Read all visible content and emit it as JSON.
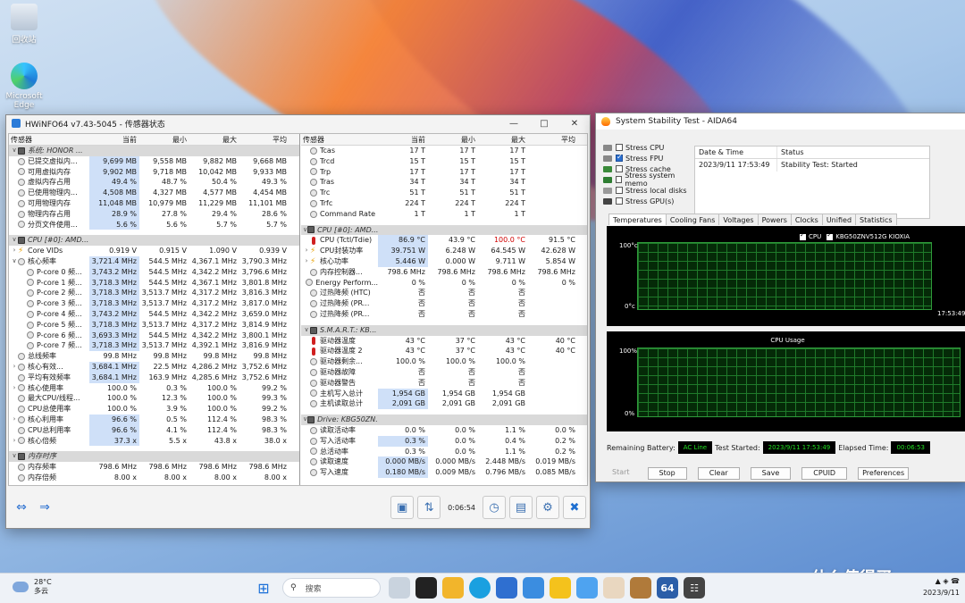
{
  "desktop": {
    "icons": [
      {
        "label": "回收站"
      },
      {
        "label": "Microsoft Edge"
      }
    ],
    "watermark": "什么值得买"
  },
  "hwinfo": {
    "title": "HWiNFO64 v7.43-5045 - 传感器状态",
    "left_headers": [
      "传感器",
      "当前",
      "最小",
      "最大",
      "平均"
    ],
    "left_rows": [
      {
        "t": "grp",
        "label": "系统: HONOR ..."
      },
      {
        "t": "r",
        "icon": "circle",
        "label": "已提交虚拟内...",
        "v": [
          "9,699 MB",
          "9,558 MB",
          "9,882 MB",
          "9,668 MB"
        ],
        "hl": true
      },
      {
        "t": "r",
        "icon": "circle",
        "label": "可用虚拟内存",
        "v": [
          "9,902 MB",
          "9,718 MB",
          "10,042 MB",
          "9,933 MB"
        ],
        "hl": true
      },
      {
        "t": "r",
        "icon": "circle",
        "label": "虚拟内存占用",
        "v": [
          "49.4 %",
          "48.7 %",
          "50.4 %",
          "49.3 %"
        ],
        "hl": true
      },
      {
        "t": "r",
        "icon": "circle",
        "label": "已使用物理内...",
        "v": [
          "4,508 MB",
          "4,327 MB",
          "4,577 MB",
          "4,454 MB"
        ],
        "hl": true
      },
      {
        "t": "r",
        "icon": "circle",
        "label": "可用物理内存",
        "v": [
          "11,048 MB",
          "10,979 MB",
          "11,229 MB",
          "11,101 MB"
        ],
        "hl": true
      },
      {
        "t": "r",
        "icon": "circle",
        "label": "物理内存占用",
        "v": [
          "28.9 %",
          "27.8 %",
          "29.4 %",
          "28.6 %"
        ],
        "hl": true
      },
      {
        "t": "r",
        "icon": "circle",
        "label": "分页文件使用...",
        "v": [
          "5.6 %",
          "5.6 %",
          "5.7 %",
          "5.7 %"
        ],
        "hl": true
      },
      {
        "t": "blank"
      },
      {
        "t": "grp",
        "label": "CPU [#0]: AMD..."
      },
      {
        "t": "r",
        "tw": ">",
        "icon": "bolt",
        "label": "Core VIDs",
        "v": [
          "0.919 V",
          "0.915 V",
          "1.090 V",
          "0.939 V"
        ]
      },
      {
        "t": "r",
        "tw": "v",
        "icon": "circle",
        "label": "核心频率",
        "v": [
          "3,721.4 MHz",
          "544.5 MHz",
          "4,367.1 MHz",
          "3,790.3 MHz"
        ],
        "hl": true
      },
      {
        "t": "r",
        "ind": true,
        "icon": "circle",
        "label": "P-core 0 频...",
        "v": [
          "3,743.2 MHz",
          "544.5 MHz",
          "4,342.2 MHz",
          "3,796.6 MHz"
        ],
        "hl": true
      },
      {
        "t": "r",
        "ind": true,
        "icon": "circle",
        "label": "P-core 1 频...",
        "v": [
          "3,718.3 MHz",
          "544.5 MHz",
          "4,367.1 MHz",
          "3,801.8 MHz"
        ],
        "hl": true
      },
      {
        "t": "r",
        "ind": true,
        "icon": "circle",
        "label": "P-core 2 频...",
        "v": [
          "3,718.3 MHz",
          "3,513.7 MHz",
          "4,317.2 MHz",
          "3,816.3 MHz"
        ],
        "hl": true
      },
      {
        "t": "r",
        "ind": true,
        "icon": "circle",
        "label": "P-core 3 频...",
        "v": [
          "3,718.3 MHz",
          "3,513.7 MHz",
          "4,317.2 MHz",
          "3,817.0 MHz"
        ],
        "hl": true
      },
      {
        "t": "r",
        "ind": true,
        "icon": "circle",
        "label": "P-core 4 频...",
        "v": [
          "3,743.2 MHz",
          "544.5 MHz",
          "4,342.2 MHz",
          "3,659.0 MHz"
        ],
        "hl": true
      },
      {
        "t": "r",
        "ind": true,
        "icon": "circle",
        "label": "P-core 5 频...",
        "v": [
          "3,718.3 MHz",
          "3,513.7 MHz",
          "4,317.2 MHz",
          "3,814.9 MHz"
        ],
        "hl": true
      },
      {
        "t": "r",
        "ind": true,
        "icon": "circle",
        "label": "P-core 6 频...",
        "v": [
          "3,693.3 MHz",
          "544.5 MHz",
          "4,342.2 MHz",
          "3,800.1 MHz"
        ],
        "hl": true
      },
      {
        "t": "r",
        "ind": true,
        "icon": "circle",
        "label": "P-core 7 频...",
        "v": [
          "3,718.3 MHz",
          "3,513.7 MHz",
          "4,392.1 MHz",
          "3,816.9 MHz"
        ],
        "hl": true
      },
      {
        "t": "r",
        "icon": "circle",
        "label": "总线频率",
        "v": [
          "99.8 MHz",
          "99.8 MHz",
          "99.8 MHz",
          "99.8 MHz"
        ]
      },
      {
        "t": "r",
        "tw": ">",
        "icon": "circle",
        "label": "核心有效...",
        "v": [
          "3,684.1 MHz",
          "22.5 MHz",
          "4,286.2 MHz",
          "3,752.6 MHz"
        ],
        "hl": true
      },
      {
        "t": "r",
        "icon": "circle",
        "label": "平均有效频率",
        "v": [
          "3,684.1 MHz",
          "163.9 MHz",
          "4,285.6 MHz",
          "3,752.6 MHz"
        ],
        "hl": true
      },
      {
        "t": "r",
        "tw": ">",
        "icon": "circle",
        "label": "核心使用率",
        "v": [
          "100.0 %",
          "0.3 %",
          "100.0 %",
          "99.2 %"
        ]
      },
      {
        "t": "r",
        "icon": "circle",
        "label": "最大CPU/线程...",
        "v": [
          "100.0 %",
          "12.3 %",
          "100.0 %",
          "99.3 %"
        ]
      },
      {
        "t": "r",
        "icon": "circle",
        "label": "CPU总使用率",
        "v": [
          "100.0 %",
          "3.9 %",
          "100.0 %",
          "99.2 %"
        ]
      },
      {
        "t": "r",
        "tw": ">",
        "icon": "circle",
        "label": "核心利用率",
        "v": [
          "96.6 %",
          "0.5 %",
          "112.4 %",
          "98.3 %"
        ],
        "hl": true
      },
      {
        "t": "r",
        "icon": "circle",
        "label": "CPU总利用率",
        "v": [
          "96.6 %",
          "4.1 %",
          "112.4 %",
          "98.3 %"
        ],
        "hl": true
      },
      {
        "t": "r",
        "tw": ">",
        "icon": "circle",
        "label": "核心倍频",
        "v": [
          "37.3 x",
          "5.5 x",
          "43.8 x",
          "38.0 x"
        ],
        "hl": true
      },
      {
        "t": "blank"
      },
      {
        "t": "grp",
        "label": "内存时序"
      },
      {
        "t": "r",
        "icon": "circle",
        "label": "内存频率",
        "v": [
          "798.6 MHz",
          "798.6 MHz",
          "798.6 MHz",
          "798.6 MHz"
        ]
      },
      {
        "t": "r",
        "icon": "circle",
        "label": "内存倍频",
        "v": [
          "8.00 x",
          "8.00 x",
          "8.00 x",
          "8.00 x"
        ]
      }
    ],
    "right_headers": [
      "传感器",
      "当前",
      "最小",
      "最大",
      "平均"
    ],
    "right_rows": [
      {
        "t": "r",
        "icon": "circle",
        "label": "Tcas",
        "v": [
          "17 T",
          "17 T",
          "17 T",
          ""
        ]
      },
      {
        "t": "r",
        "icon": "circle",
        "label": "Trcd",
        "v": [
          "15 T",
          "15 T",
          "15 T",
          ""
        ]
      },
      {
        "t": "r",
        "icon": "circle",
        "label": "Trp",
        "v": [
          "17 T",
          "17 T",
          "17 T",
          ""
        ]
      },
      {
        "t": "r",
        "icon": "circle",
        "label": "Tras",
        "v": [
          "34 T",
          "34 T",
          "34 T",
          ""
        ]
      },
      {
        "t": "r",
        "icon": "circle",
        "label": "Trc",
        "v": [
          "51 T",
          "51 T",
          "51 T",
          ""
        ]
      },
      {
        "t": "r",
        "icon": "circle",
        "label": "Trfc",
        "v": [
          "224 T",
          "224 T",
          "224 T",
          ""
        ]
      },
      {
        "t": "r",
        "icon": "circle",
        "label": "Command Rate",
        "v": [
          "1 T",
          "1 T",
          "1 T",
          ""
        ]
      },
      {
        "t": "blank"
      },
      {
        "t": "grp",
        "label": "CPU [#0]: AMD..."
      },
      {
        "t": "r",
        "icon": "therm",
        "label": "CPU (Tctl/Tdie)",
        "v": [
          "86.9 °C",
          "43.9 °C",
          "100.0 °C",
          "91.5 °C"
        ],
        "hl": true,
        "red": 2
      },
      {
        "t": "r",
        "tw": ">",
        "icon": "bolt",
        "label": "CPU封装功率",
        "v": [
          "39.751 W",
          "6.248 W",
          "64.545 W",
          "42.628 W"
        ],
        "hl": true
      },
      {
        "t": "r",
        "tw": ">",
        "icon": "bolt",
        "label": "核心功率",
        "v": [
          "5.446 W",
          "0.000 W",
          "9.711 W",
          "5.854 W"
        ],
        "hl": true
      },
      {
        "t": "r",
        "icon": "circle",
        "label": "内存控制器...",
        "v": [
          "798.6 MHz",
          "798.6 MHz",
          "798.6 MHz",
          "798.6 MHz"
        ]
      },
      {
        "t": "r",
        "icon": "circle",
        "label": "Energy Perform...",
        "v": [
          "0 %",
          "0 %",
          "0 %",
          "0 %"
        ]
      },
      {
        "t": "r",
        "icon": "circle",
        "label": "过热降频 (HTC)",
        "v": [
          "否",
          "否",
          "否",
          ""
        ]
      },
      {
        "t": "r",
        "icon": "circle",
        "label": "过热降频 (PR...",
        "v": [
          "否",
          "否",
          "否",
          ""
        ]
      },
      {
        "t": "r",
        "icon": "circle",
        "label": "过热降频 (PR...",
        "v": [
          "否",
          "否",
          "否",
          ""
        ]
      },
      {
        "t": "blank"
      },
      {
        "t": "grp",
        "label": "S.M.A.R.T.: KB..."
      },
      {
        "t": "r",
        "icon": "therm",
        "label": "驱动器温度",
        "v": [
          "43 °C",
          "37 °C",
          "43 °C",
          "40 °C"
        ]
      },
      {
        "t": "r",
        "icon": "therm",
        "label": "驱动器温度 2",
        "v": [
          "43 °C",
          "37 °C",
          "43 °C",
          "40 °C"
        ]
      },
      {
        "t": "r",
        "icon": "circle",
        "label": "驱动器剩余...",
        "v": [
          "100.0 %",
          "100.0 %",
          "100.0 %",
          ""
        ]
      },
      {
        "t": "r",
        "icon": "circle",
        "label": "驱动器故障",
        "v": [
          "否",
          "否",
          "否",
          ""
        ]
      },
      {
        "t": "r",
        "icon": "circle",
        "label": "驱动器警告",
        "v": [
          "否",
          "否",
          "否",
          ""
        ]
      },
      {
        "t": "r",
        "icon": "circle",
        "label": "主机写入总计",
        "v": [
          "1,954 GB",
          "1,954 GB",
          "1,954 GB",
          ""
        ],
        "hl": true
      },
      {
        "t": "r",
        "icon": "circle",
        "label": "主机读取总计",
        "v": [
          "2,091 GB",
          "2,091 GB",
          "2,091 GB",
          ""
        ],
        "hl": true
      },
      {
        "t": "blank"
      },
      {
        "t": "grp",
        "label": "Drive: KBG50ZN..."
      },
      {
        "t": "r",
        "icon": "circle",
        "label": "读取活动率",
        "v": [
          "0.0 %",
          "0.0 %",
          "1.1 %",
          "0.0 %"
        ]
      },
      {
        "t": "r",
        "icon": "circle",
        "label": "写入活动率",
        "v": [
          "0.3 %",
          "0.0 %",
          "0.4 %",
          "0.2 %"
        ],
        "hl": true
      },
      {
        "t": "r",
        "icon": "circle",
        "label": "总活动率",
        "v": [
          "0.3 %",
          "0.0 %",
          "1.1 %",
          "0.2 %"
        ]
      },
      {
        "t": "r",
        "icon": "circle",
        "label": "读取速度",
        "v": [
          "0.000 MB/s",
          "0.000 MB/s",
          "2.448 MB/s",
          "0.019 MB/s"
        ],
        "hl": true
      },
      {
        "t": "r",
        "icon": "circle",
        "label": "写入速度",
        "v": [
          "0.180 MB/s",
          "0.009 MB/s",
          "0.796 MB/s",
          "0.085 MB/s"
        ],
        "hl": true
      }
    ],
    "toolbar": {
      "elapsed": "0:06:54"
    }
  },
  "aida": {
    "title": "System Stability Test - AIDA64",
    "stress_options": [
      {
        "label": "Stress CPU",
        "checked": false
      },
      {
        "label": "Stress FPU",
        "checked": true
      },
      {
        "label": "Stress cache",
        "checked": false
      },
      {
        "label": "Stress system memo",
        "checked": false
      },
      {
        "label": "Stress local disks",
        "checked": false
      },
      {
        "label": "Stress GPU(s)",
        "checked": false
      }
    ],
    "status_table": {
      "headers": [
        "Date & Time",
        "Status"
      ],
      "rows": [
        [
          "2023/9/11 17:53:49",
          "Stability Test: Started"
        ]
      ]
    },
    "tabs": [
      "Temperatures",
      "Cooling Fans",
      "Voltages",
      "Powers",
      "Clocks",
      "Unified",
      "Statistics"
    ],
    "temp_graph": {
      "legend": [
        "CPU",
        "KBG50ZNV512G KIOXIA"
      ],
      "ymax": "100°c",
      "ymin": "0°c",
      "time": "17:53:49"
    },
    "cpu_graph": {
      "title": "CPU Usage",
      "ymax": "100%",
      "ymin": "0%"
    },
    "bottom": {
      "battery_label": "Remaining Battery:",
      "battery_value": "AC Line",
      "started_label": "Test Started:",
      "started_value": "2023/9/11 17:53:49",
      "elapsed_label": "Elapsed Time:",
      "elapsed_value": "00:06:53"
    },
    "buttons": [
      "Start",
      "Stop",
      "Clear",
      "Save",
      "CPUID",
      "Preferences"
    ]
  },
  "taskbar": {
    "temp": "28°C",
    "weather": "多云",
    "search": "搜索",
    "date": "2023/9/11"
  },
  "chart_data": [
    {
      "type": "line",
      "title": "",
      "ylabel": "",
      "ylim": [
        0,
        100
      ],
      "series": [
        {
          "name": "CPU",
          "values": []
        },
        {
          "name": "KBG50ZNV512G KIOXIA",
          "values": []
        }
      ]
    },
    {
      "type": "line",
      "title": "CPU Usage",
      "ylim": [
        0,
        100
      ],
      "series": [
        {
          "values": []
        }
      ]
    }
  ]
}
